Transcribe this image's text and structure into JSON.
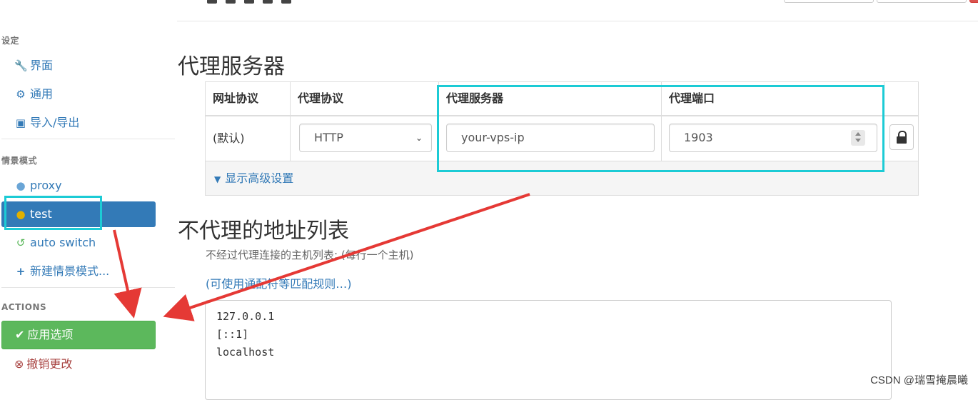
{
  "colors": {
    "primary": "#337ab7",
    "success": "#5cb85c",
    "danger": "#a94442",
    "highlight": "#1ccbd5",
    "arrow": "#e53935"
  },
  "sidebar": {
    "settings_header": "设定",
    "settings_items": [
      {
        "label": "界面",
        "icon": "wrench-icon"
      },
      {
        "label": "通用",
        "icon": "gear-icon"
      },
      {
        "label": "导入/导出",
        "icon": "floppy-icon"
      }
    ],
    "profiles_header": "情景模式",
    "profiles": [
      {
        "label": "proxy",
        "icon": "globe-icon"
      },
      {
        "label": "test",
        "icon": "globe-icon",
        "active": true
      },
      {
        "label": "auto switch",
        "icon": "retweet-icon"
      },
      {
        "label": "新建情景模式...",
        "icon": "plus-icon"
      }
    ],
    "actions_header": "ACTIONS",
    "apply_label": "应用选项",
    "revert_label": "撤销更改"
  },
  "main": {
    "proxy_section_title": "代理服务器",
    "table": {
      "headers": [
        "网址协议",
        "代理协议",
        "代理服务器",
        "代理端口"
      ],
      "row": {
        "scheme": "(默认)",
        "protocol": "HTTP",
        "server": "your-vps-ip",
        "port": "1903"
      },
      "advanced_label": "显示高级设置"
    },
    "bypass_section_title": "不代理的地址列表",
    "bypass_help": "不经过代理连接的主机列表: (每行一个主机)",
    "wildcard_link": "(可使用通配符等匹配规则…)",
    "bypass_list": [
      "127.0.0.1",
      "[::1]",
      "localhost"
    ]
  },
  "watermark": "CSDN @瑞雪掩晨曦"
}
